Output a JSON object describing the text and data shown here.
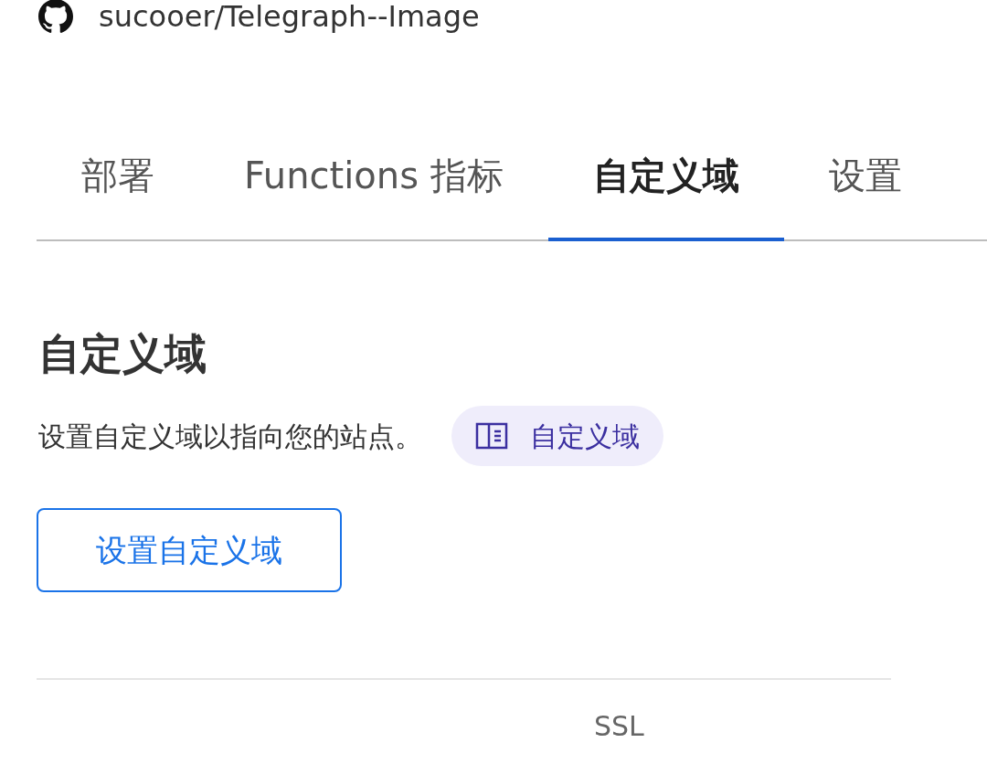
{
  "repo": {
    "name": "sucooer/Telegraph--Image"
  },
  "tabs": [
    {
      "label": "部署",
      "selected": false
    },
    {
      "label": "Functions 指标",
      "selected": false
    },
    {
      "label": "自定义域",
      "selected": true
    },
    {
      "label": "设置",
      "selected": false
    }
  ],
  "section": {
    "title": "自定义域",
    "description": "设置自定义域以指向您的站点。",
    "doc_link": "自定义域",
    "button": "设置自定义域"
  },
  "table": {
    "columns": [
      "SSL"
    ]
  }
}
